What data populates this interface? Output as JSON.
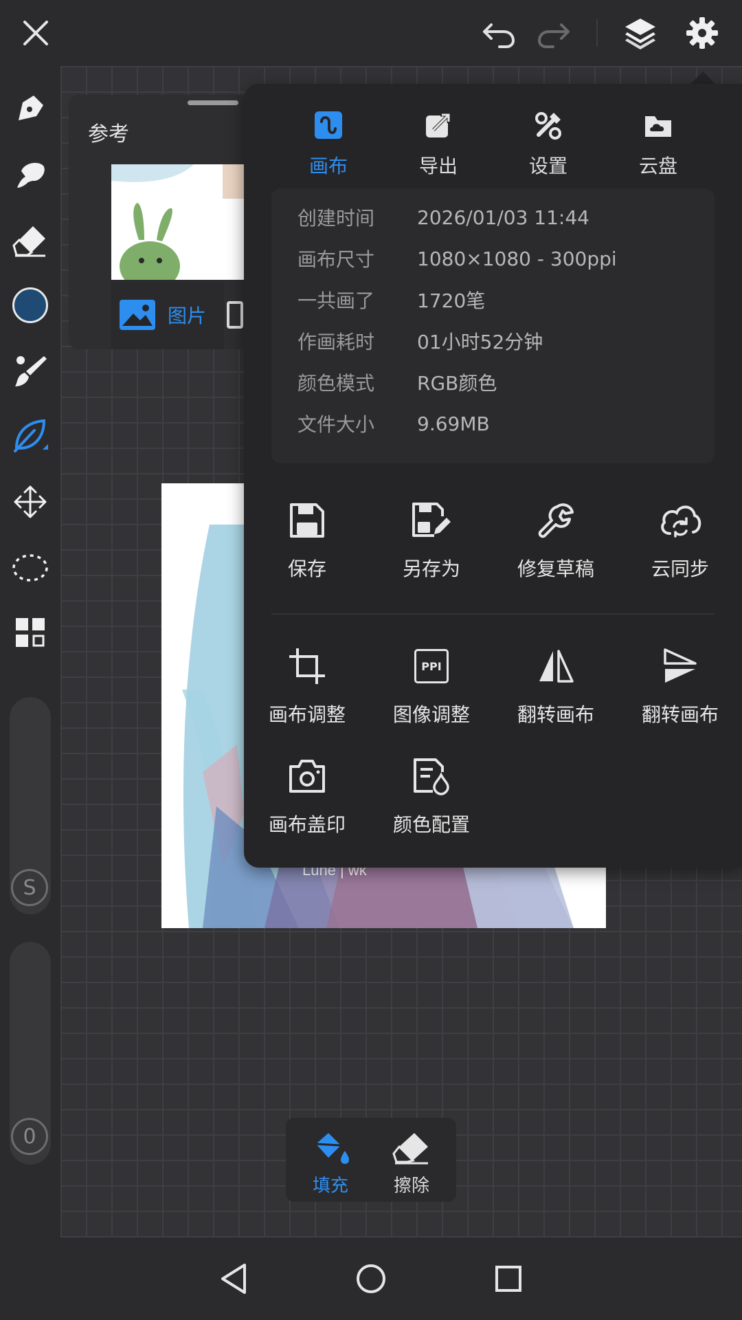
{
  "reference": {
    "title": "参考",
    "picture_tab": "图片"
  },
  "popup": {
    "tabs": [
      {
        "label": "画布",
        "icon": "canvas-icon",
        "active": true
      },
      {
        "label": "导出",
        "icon": "export-icon",
        "active": false
      },
      {
        "label": "设置",
        "icon": "tools-settings-icon",
        "active": false
      },
      {
        "label": "云盘",
        "icon": "cloud-drive-icon",
        "active": false
      }
    ],
    "info": [
      {
        "key": "创建时间",
        "value": "2026/01/03 11:44"
      },
      {
        "key": "画布尺寸",
        "value": "1080×1080 - 300ppi"
      },
      {
        "key": "一共画了",
        "value": "1720笔"
      },
      {
        "key": "作画耗时",
        "value": "01小时52分钟"
      },
      {
        "key": "颜色模式",
        "value": "RGB颜色"
      },
      {
        "key": "文件大小",
        "value": "9.69MB"
      }
    ],
    "actions_row1": [
      {
        "label": "保存",
        "icon": "save-icon"
      },
      {
        "label": "另存为",
        "icon": "save-as-icon"
      },
      {
        "label": "修复草稿",
        "icon": "wrench-icon"
      },
      {
        "label": "云同步",
        "icon": "cloud-sync-icon"
      }
    ],
    "actions_row2": [
      {
        "label": "画布调整",
        "icon": "crop-icon"
      },
      {
        "label": "图像调整",
        "icon": "ppi-icon",
        "badge": "PPI"
      },
      {
        "label": "翻转画布",
        "icon": "flip-horizontal-icon"
      },
      {
        "label": "翻转画布",
        "icon": "flip-vertical-icon"
      }
    ],
    "actions_row3": [
      {
        "label": "画布盖印",
        "icon": "camera-icon"
      },
      {
        "label": "颜色配置",
        "icon": "color-profile-icon"
      }
    ]
  },
  "left_toolbar": {
    "size_slider_label": "S",
    "opacity_slider_label": "0",
    "current_color": "#1e4a73"
  },
  "fill_panel": {
    "fill_label": "填充",
    "erase_label": "擦除"
  },
  "artwork": {
    "signature": "Lune | wk"
  },
  "colors": {
    "accent": "#2e8ef0",
    "panel": "#252527",
    "background": "#2a2a2c"
  }
}
